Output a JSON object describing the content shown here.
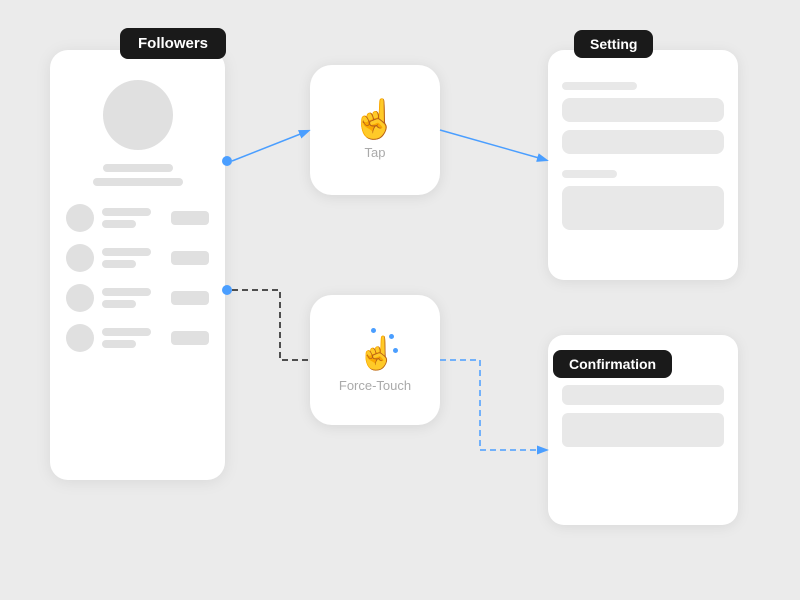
{
  "followers": {
    "label": "Followers"
  },
  "tap": {
    "label": "Tap"
  },
  "forceTouch": {
    "label": "Force-Touch"
  },
  "setting": {
    "label": "Setting"
  },
  "confirmation": {
    "label": "Confirmation"
  }
}
